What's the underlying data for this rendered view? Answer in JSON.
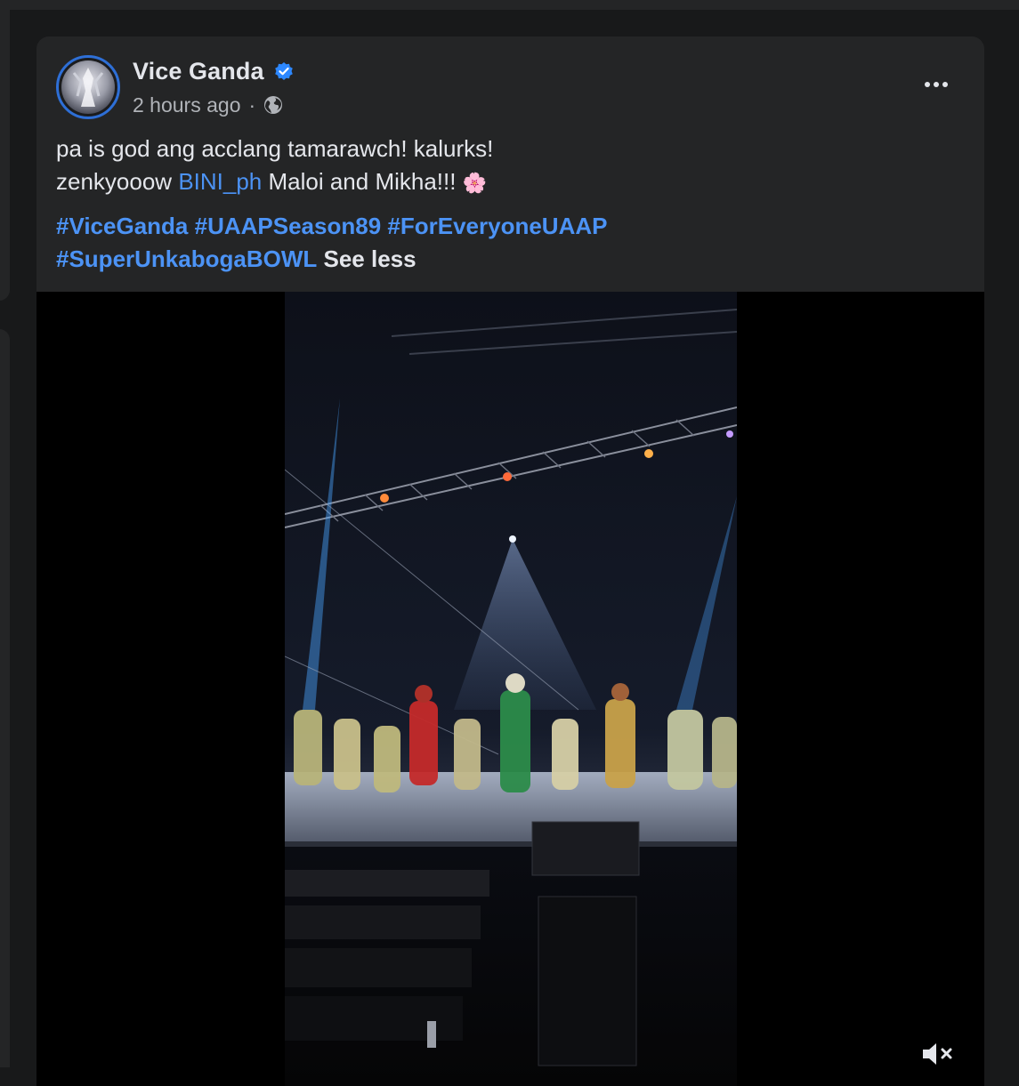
{
  "post": {
    "author": {
      "name": "Vice Ganda",
      "verified": true,
      "avatar": "avatar"
    },
    "meta": {
      "time": "2 hours ago",
      "separator": "·",
      "audience_icon": "globe-icon"
    },
    "menu_icon": "more-options-icon",
    "caption": {
      "line1": "pa is god ang acclang tamarawch! kalurks!",
      "line2_prefix": "zenkyooow ",
      "line2_link": "BINI_ph",
      "line2_suffix": " Maloi and Mikha!!! ",
      "line2_emoji": "🌸",
      "hashtags_line1": [
        "#ViceGanda",
        "#UAAPSeason89",
        "#ForEveryoneUAAP"
      ],
      "hashtags_line2": [
        "#SuperUnkabogaBOWL"
      ],
      "see_less": "See less"
    },
    "video": {
      "mute_icon": "muted-speaker-icon"
    }
  },
  "colors": {
    "background": "#18191a",
    "card": "#242526",
    "primary_text": "#e4e6eb",
    "secondary_text": "#b0b3b8",
    "link": "#4c93f5",
    "verified": "#2d88ff"
  }
}
